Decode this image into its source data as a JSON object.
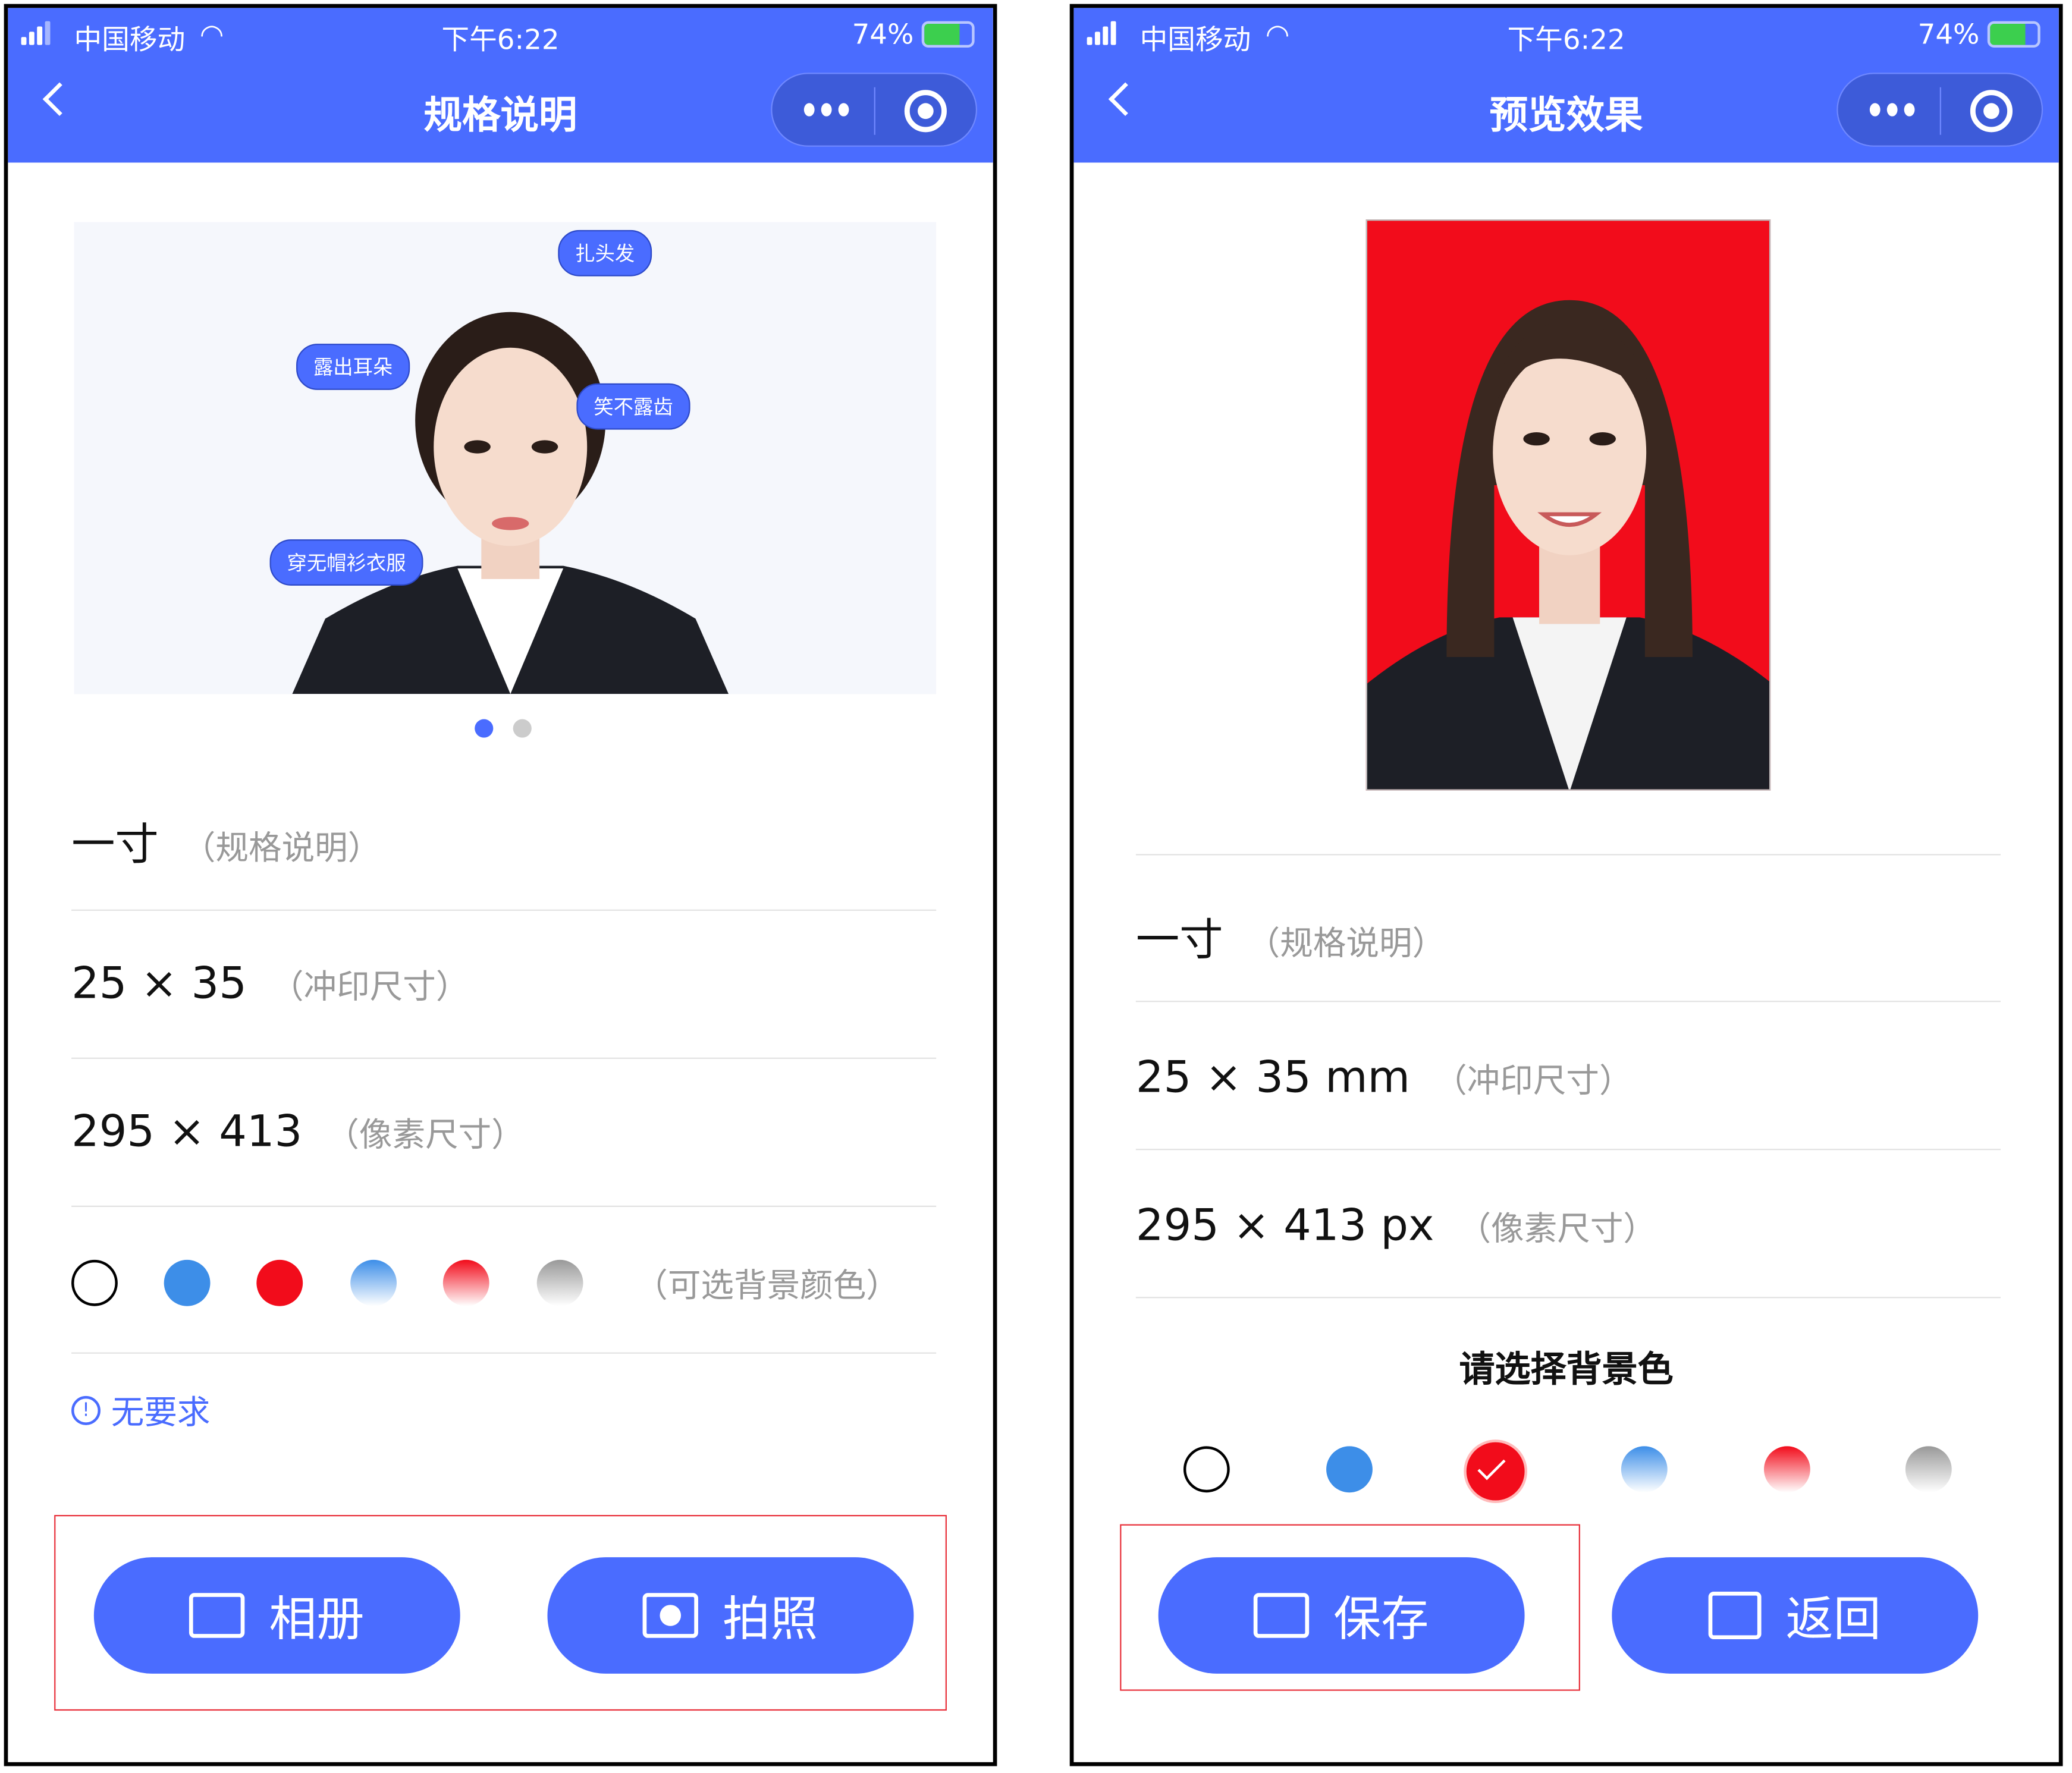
{
  "status_bar": {
    "carrier": "中国移动",
    "time": "下午6:22",
    "battery": "74%"
  },
  "left": {
    "title": "规格说明",
    "guide_tags": [
      "扎头发",
      "露出耳朵",
      "笑不露齿",
      "穿无帽衫衣服"
    ],
    "carousel": {
      "pages": 2,
      "active": 1
    },
    "spec_name": "一寸",
    "spec_name_hint": "（规格说明）",
    "print_size": "25 × 35",
    "print_size_hint": "（冲印尺寸）",
    "pixel_size": "295 × 413",
    "pixel_size_hint": "（像素尺寸）",
    "colors_hint": "（可选背景颜色）",
    "requirement": "无要求",
    "buttons": {
      "album": "相册",
      "camera": "拍照"
    }
  },
  "right": {
    "title": "预览效果",
    "spec_name": "一寸",
    "spec_name_hint": "（规格说明）",
    "print_size": "25 × 35 mm",
    "print_size_hint": "（冲印尺寸）",
    "pixel_size": "295 × 413 px",
    "pixel_size_hint": "（像素尺寸）",
    "choose_bg": "请选择背景色",
    "selected_color": "red",
    "buttons": {
      "save": "保存",
      "back": "返回"
    }
  },
  "colors": {
    "accent": "#4a6cff",
    "white": "#ffffff",
    "blue": "#3d8ee8",
    "red": "#f20c1b",
    "blue_gradient": "#3d8ee8",
    "red_gradient": "#f20c1b",
    "gray_gradient": "#999999"
  }
}
